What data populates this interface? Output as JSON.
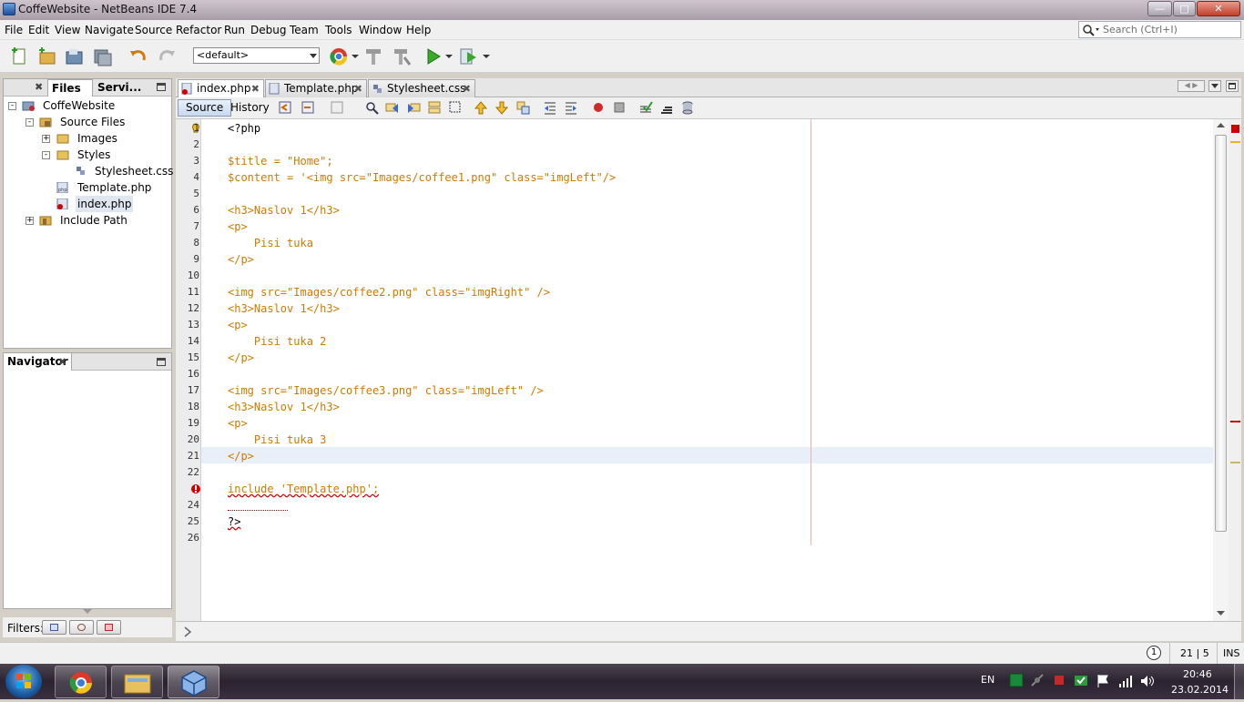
{
  "window": {
    "title": "CoffeWebsite - NetBeans IDE 7.4"
  },
  "menu": [
    "File",
    "Edit",
    "View",
    "Navigate",
    "Source",
    "Refactor",
    "Run",
    "Debug",
    "Team",
    "Tools",
    "Window",
    "Help"
  ],
  "search": {
    "placeholder": "Search (Ctrl+I)"
  },
  "toolbar": {
    "config_value": "<default>"
  },
  "projects_panel": {
    "tabs": [
      "Files",
      "Servi..."
    ],
    "tree": [
      {
        "label": "CoffeWebsite",
        "level": 0
      },
      {
        "label": "Source Files",
        "level": 1
      },
      {
        "label": "Images",
        "level": 2
      },
      {
        "label": "Styles",
        "level": 2
      },
      {
        "label": "Stylesheet.css",
        "level": 3
      },
      {
        "label": "Template.php",
        "level": 2
      },
      {
        "label": "index.php",
        "level": 2,
        "selected": true
      },
      {
        "label": "Include Path",
        "level": 1
      }
    ]
  },
  "navigator": {
    "title": "Navigator"
  },
  "filters": {
    "label": "Filters:"
  },
  "editor": {
    "tabs": [
      {
        "label": "index.php",
        "active": true
      },
      {
        "label": "Template.php",
        "active": false
      },
      {
        "label": "Stylesheet.css",
        "active": false
      }
    ],
    "source_label": "Source",
    "history_label": "History",
    "lines": [
      "<?php",
      "",
      "$title = \"Home\";",
      "$content = '<img src=\"Images/coffee1.png\" class=\"imgLeft\"/>",
      "",
      "<h3>Naslov 1</h3>",
      "<p>",
      "    Pisi tuka",
      "</p>",
      "",
      "<img src=\"Images/coffee2.png\" class=\"imgRight\" />",
      "<h3>Naslov 1</h3>",
      "<p>",
      "    Pisi tuka 2",
      "</p>",
      "",
      "<img src=\"Images/coffee3.png\" class=\"imgLeft\" />",
      "<h3>Naslov 1</h3>",
      "<p>",
      "    Pisi tuka 3",
      "</p>",
      "",
      "include 'Template.php';",
      "",
      "?>",
      ""
    ],
    "line_numbers": [
      "1",
      "2",
      "3",
      "4",
      "5",
      "6",
      "7",
      "8",
      "9",
      "10",
      "11",
      "12",
      "13",
      "14",
      "15",
      "16",
      "17",
      "18",
      "19",
      "20",
      "21",
      "22",
      "23",
      "24",
      "25",
      "26"
    ],
    "current_line": 21
  },
  "status": {
    "position": "21 | 5",
    "mode": "INS",
    "notifications": "1"
  },
  "taskbar": {
    "lang": "EN",
    "time": "20:46",
    "date": "23.02.2014"
  },
  "colors": {
    "string": "#ce7b00",
    "error": "#d00000",
    "current_line": "#e9eff8"
  }
}
